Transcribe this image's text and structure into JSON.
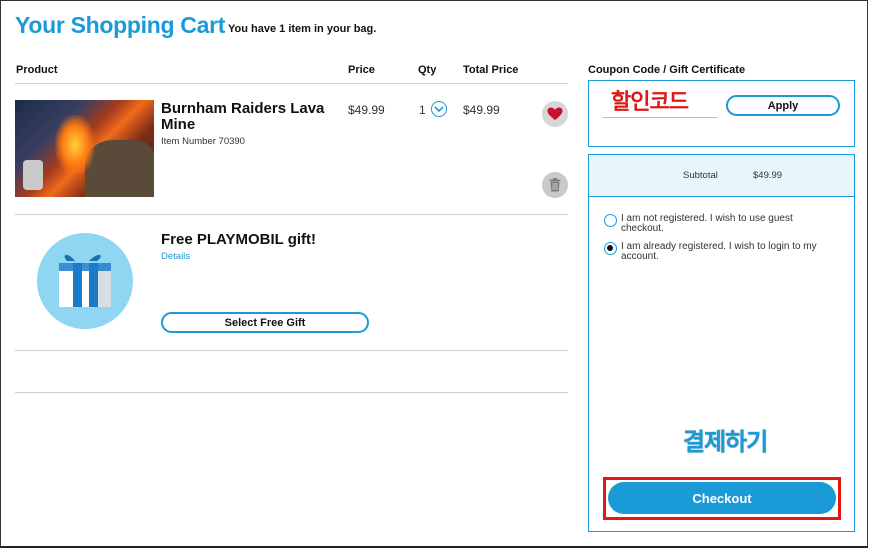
{
  "header": {
    "title": "Your Shopping Cart",
    "subtitle": "You have 1 item in your bag."
  },
  "table": {
    "columns": [
      "Product",
      "Price",
      "Qty",
      "Total Price"
    ]
  },
  "cart_item": {
    "name": "Burnham Raiders Lava Mine",
    "item_number": "Item Number 70390",
    "price": "$49.99",
    "qty": "1",
    "total": "$49.99",
    "wishlist_icon": "heart-icon",
    "remove_icon": "trash-icon"
  },
  "gift": {
    "name": "Free PLAYMOBIL gift!",
    "details_link": "Details",
    "select_button": "Select Free Gift"
  },
  "coupon": {
    "heading": "Coupon Code / Gift Certificate",
    "input_value": "할인코드",
    "apply_button": "Apply"
  },
  "summary": {
    "subtotal_label": "Subtotal",
    "subtotal_value": "$49.99"
  },
  "login_options": [
    {
      "label": "I am not registered. I wish to use guest checkout.",
      "selected": false
    },
    {
      "label": "I am already registered. I wish to login to my account.",
      "selected": true
    }
  ],
  "annotation": {
    "checkout_korean": "결제하기",
    "highlight_color": "#e01818"
  },
  "checkout": {
    "button_label": "Checkout"
  },
  "colors": {
    "accent": "#1a9ad6",
    "gift_circle": "#8ed6f1"
  }
}
